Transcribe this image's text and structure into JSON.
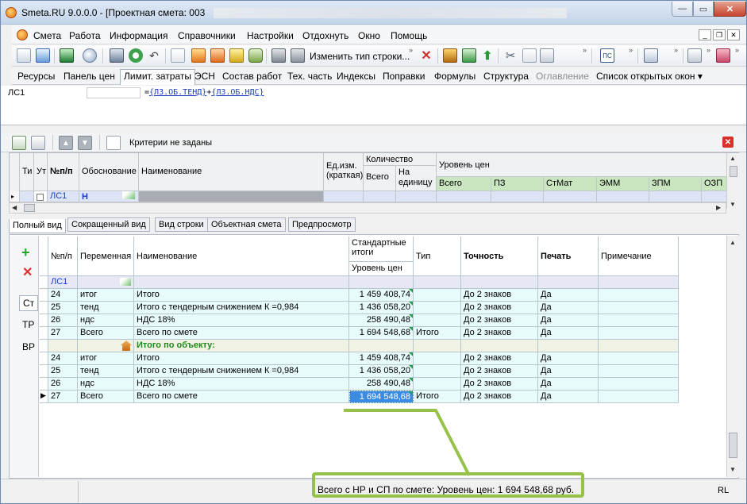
{
  "window": {
    "title": "Smeta.RU  9.0.0.0  - [Проектная смета: 003",
    "min_glyph": "—",
    "max_glyph": "▭",
    "close_glyph": "✕"
  },
  "menu": {
    "items": [
      "Смета",
      "Работа",
      "Информация",
      "Справочники",
      "Настройки",
      "Отдохнуть",
      "Окно",
      "Помощь"
    ],
    "mdi_controls": [
      "_",
      "❐",
      "✕"
    ]
  },
  "toolbar": {
    "change_row_type": "Изменить тип строки...",
    "overflow": "»"
  },
  "tabs": {
    "items": [
      {
        "label": "Ресурсы",
        "state": "normal"
      },
      {
        "label": "Панель цен",
        "state": "normal"
      },
      {
        "label": "Лимит. затраты",
        "state": "active"
      },
      {
        "label": "ЭСН",
        "state": "normal"
      },
      {
        "label": "Состав работ",
        "state": "normal"
      },
      {
        "label": "Тех. часть",
        "state": "normal"
      },
      {
        "label": "Индексы",
        "state": "normal"
      },
      {
        "label": "Поправки",
        "state": "normal"
      },
      {
        "label": "Формулы",
        "state": "normal"
      },
      {
        "label": "Структура",
        "state": "normal"
      },
      {
        "label": "Оглавление",
        "state": "disabled"
      },
      {
        "label": "Список открытых окон ▾",
        "state": "normal"
      }
    ]
  },
  "formula": {
    "name": "ЛС1",
    "eq": "=",
    "term1": "{ЛЗ.ОБ.ТЕНД}",
    "plus": "+",
    "term2": "{ЛЗ.ОБ.НДС}"
  },
  "criteria": {
    "text": "Критерии не заданы",
    "close": "✕"
  },
  "top_grid": {
    "headers": {
      "ti": "Ти",
      "ut": "Ут",
      "npp": "№п/п",
      "basis": "Обоснование",
      "name": "Наименование",
      "unit": "Ед.изм. (краткая)",
      "qty": "Количество",
      "qty_total": "Всего",
      "qty_per": "На единицу",
      "price_level": "Уровень цен",
      "sub": [
        "Всего",
        "ПЗ",
        "СтМат",
        "ЭММ",
        "ЗПМ",
        "ОЗП"
      ]
    },
    "row": {
      "marker": "▸",
      "npp": "ЛС1",
      "basis": "Н"
    }
  },
  "bottom_tabs": [
    "Полный вид",
    "Сокращенный вид",
    "Вид строки",
    "Объектная смета",
    "Предпросмотр"
  ],
  "sidebar": {
    "add": "+",
    "del": "✕",
    "items": [
      "Ст",
      "ТР",
      "ВР"
    ]
  },
  "grid": {
    "headers": {
      "npp": "№п/п",
      "var": "Переменная",
      "name": "Наименование",
      "std": "Стандартные итоги",
      "level": "Уровень цен",
      "type": "Тип",
      "precision": "Точность",
      "print": "Печать",
      "note": "Примечание"
    },
    "rows": [
      {
        "kind": "group",
        "npp": "ЛС1",
        "var": "",
        "name": "",
        "value": "",
        "type": "",
        "precision": "",
        "print": "",
        "note": ""
      },
      {
        "kind": "data",
        "npp": "24",
        "var": "итог",
        "name": "Итого",
        "value": "1 459 408,74",
        "type": "",
        "precision": "До 2 знаков",
        "print": "Да",
        "note": ""
      },
      {
        "kind": "data",
        "npp": "25",
        "var": "тенд",
        "name": "Итого с тендерным снижением К =0,984",
        "value": "1 436 058,20",
        "type": "",
        "precision": "До 2 знаков",
        "print": "Да",
        "note": ""
      },
      {
        "kind": "data",
        "npp": "26",
        "var": "ндс",
        "name": "НДС 18%",
        "value": "258 490,48",
        "type": "",
        "precision": "До 2 знаков",
        "print": "Да",
        "note": ""
      },
      {
        "kind": "data",
        "npp": "27",
        "var": "Всего",
        "name": "Всего по смете",
        "value": "1 694 548,68",
        "type": "Итого",
        "precision": "До 2 знаков",
        "print": "Да",
        "note": ""
      },
      {
        "kind": "object",
        "npp": "",
        "var": "",
        "name": "Итого по объекту:",
        "value": "",
        "type": "",
        "precision": "",
        "print": "",
        "note": ""
      },
      {
        "kind": "data",
        "npp": "24",
        "var": "итог",
        "name": "Итого",
        "value": "1 459 408,74",
        "type": "",
        "precision": "До 2 знаков",
        "print": "Да",
        "note": ""
      },
      {
        "kind": "data",
        "npp": "25",
        "var": "тенд",
        "name": "Итого с тендерным снижением К =0,984",
        "value": "1 436 058,20",
        "type": "",
        "precision": "До 2 знаков",
        "print": "Да",
        "note": ""
      },
      {
        "kind": "data",
        "npp": "26",
        "var": "ндс",
        "name": "НДС 18%",
        "value": "258 490,48",
        "type": "",
        "precision": "До 2 знаков",
        "print": "Да",
        "note": ""
      },
      {
        "kind": "selected",
        "npp": "27",
        "var": "Всего",
        "name": "Всего по смете",
        "value": "1 694 548,68",
        "type": "Итого",
        "precision": "До 2 знаков",
        "print": "Да",
        "note": ""
      }
    ]
  },
  "status": {
    "text": "Всего с НР и СП по смете: Уровень цен: 1 694 548,68 руб.",
    "lang": "RL"
  },
  "colors": {
    "accent": "#96c24a",
    "selection": "#3b8cde",
    "row_cyan": "#e8fbfb",
    "row_lavender": "#e6e8f6",
    "object_text": "#1f8a1a"
  }
}
